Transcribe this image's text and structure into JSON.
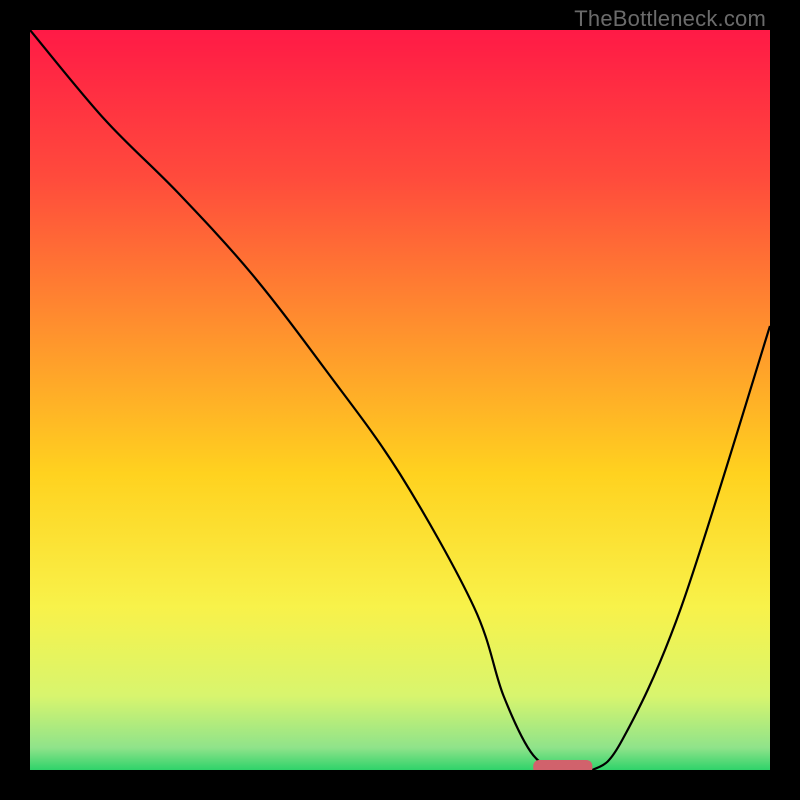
{
  "watermark": "TheBottleneck.com",
  "chart_data": {
    "type": "line",
    "title": "",
    "xlabel": "",
    "ylabel": "",
    "xlim": [
      0,
      100
    ],
    "ylim": [
      0,
      100
    ],
    "grid": false,
    "x": [
      0,
      10,
      20,
      30,
      40,
      50,
      60,
      64,
      68,
      72,
      76,
      80,
      88,
      100
    ],
    "y": [
      100,
      88,
      78,
      67,
      54,
      40,
      22,
      10,
      2,
      0,
      0,
      4,
      22,
      60
    ],
    "optimal_marker": {
      "x_start": 68,
      "x_end": 76,
      "y": 0
    },
    "gradient_stops": [
      {
        "offset": 0.0,
        "color": "#ff1a46"
      },
      {
        "offset": 0.2,
        "color": "#ff4b3c"
      },
      {
        "offset": 0.4,
        "color": "#ff8f2e"
      },
      {
        "offset": 0.6,
        "color": "#ffd21f"
      },
      {
        "offset": 0.78,
        "color": "#f8f24a"
      },
      {
        "offset": 0.9,
        "color": "#d8f56e"
      },
      {
        "offset": 0.97,
        "color": "#8fe38a"
      },
      {
        "offset": 1.0,
        "color": "#2fd36a"
      }
    ]
  }
}
